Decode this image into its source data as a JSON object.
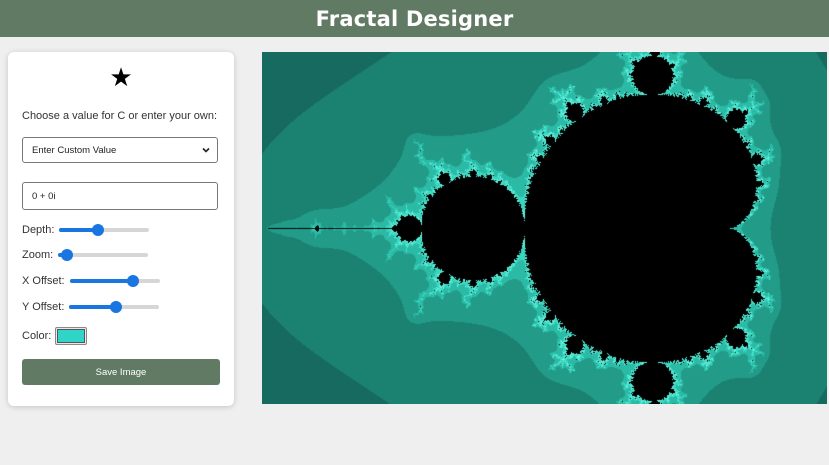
{
  "header": {
    "title": "Fractal Designer"
  },
  "panel": {
    "star_glyph": "★",
    "prompt": "Choose a value for C or enter your own:",
    "preset_select": {
      "value": "Enter Custom Value"
    },
    "c_input": {
      "value": "0 + 0i"
    },
    "sliders": {
      "depth": {
        "label": "Depth:",
        "level": 0.43
      },
      "zoom": {
        "label": "Zoom:",
        "level": 0.1
      },
      "xoffset": {
        "label": "X Offset:",
        "level": 0.7
      },
      "yoffset": {
        "label": "Y Offset:",
        "level": 0.52
      }
    },
    "color": {
      "label": "Color:",
      "value": "#2fd6c8"
    },
    "save_label": "Save Image"
  },
  "canvas": {
    "fractal": "mandelbrot",
    "colors": [
      "#0f3c36",
      "#14534b",
      "#176a5f",
      "#1b8272",
      "#229c89",
      "#2bbaa5",
      "#39d6c0",
      "#63f0dc",
      "#000000"
    ]
  },
  "accent": "#617a64"
}
